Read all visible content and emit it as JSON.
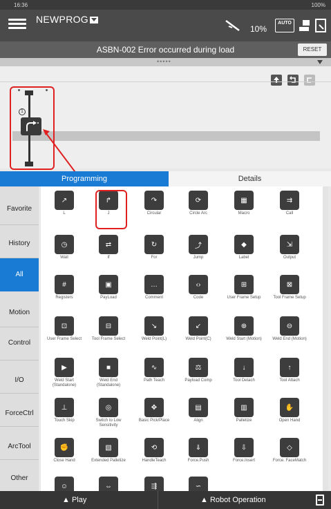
{
  "status_bar": {
    "time": "16:36",
    "battery": "100%"
  },
  "header": {
    "program_name": "NEWPROG",
    "speed_percent": "10%",
    "mode_badge": "AUTO"
  },
  "error_bar": {
    "message": "ASBN-002  Error occurred during load",
    "reset_label": "RESET"
  },
  "editor": {
    "node_number": "1"
  },
  "tabs": [
    {
      "label": "Programming",
      "active": true
    },
    {
      "label": "Details",
      "active": false
    }
  ],
  "categories": [
    {
      "label": "Favorite"
    },
    {
      "label": "History"
    },
    {
      "label": "All",
      "active": true
    },
    {
      "label": "Motion"
    },
    {
      "label": "Control"
    },
    {
      "label": "I/O"
    },
    {
      "label": "ForceCtrl"
    },
    {
      "label": "ArcTool"
    },
    {
      "label": "Other"
    }
  ],
  "commands": [
    {
      "label": "L",
      "icon": "linear-move-icon"
    },
    {
      "label": "J",
      "icon": "joint-move-icon"
    },
    {
      "label": "Circular",
      "icon": "circular-move-icon"
    },
    {
      "label": "Circle Arc",
      "icon": "circle-arc-icon"
    },
    {
      "label": "Macro",
      "icon": "macro-icon"
    },
    {
      "label": "Call",
      "icon": "call-icon"
    },
    {
      "label": "Wait",
      "icon": "stopwatch-icon"
    },
    {
      "label": "If",
      "icon": "if-branch-icon"
    },
    {
      "label": "For",
      "icon": "for-loop-icon"
    },
    {
      "label": "Jump",
      "icon": "jump-icon"
    },
    {
      "label": "Label",
      "icon": "tag-icon"
    },
    {
      "label": "Output",
      "icon": "output-icon"
    },
    {
      "label": "Registers",
      "icon": "registers-icon"
    },
    {
      "label": "PayLoad",
      "icon": "payload-icon"
    },
    {
      "label": "Comment",
      "icon": "comment-icon"
    },
    {
      "label": "Code",
      "icon": "code-icon"
    },
    {
      "label": "User Frame Setup",
      "icon": "user-frame-setup-icon"
    },
    {
      "label": "Tool Frame Setup",
      "icon": "tool-frame-setup-icon"
    },
    {
      "label": "User Frame Select",
      "icon": "user-frame-select-icon"
    },
    {
      "label": "Tool Frame Select",
      "icon": "tool-frame-select-icon"
    },
    {
      "label": "Weld Point(L)",
      "icon": "weld-point-l-icon"
    },
    {
      "label": "Weld Point(C)",
      "icon": "weld-point-c-icon"
    },
    {
      "label": "Weld Start (Motion)",
      "icon": "weld-start-motion-icon"
    },
    {
      "label": "Weld End (Motion)",
      "icon": "weld-end-motion-icon"
    },
    {
      "label": "Weld Start (Standalone)",
      "icon": "weld-start-standalone-icon"
    },
    {
      "label": "Weld End (Standalone)",
      "icon": "weld-end-standalone-icon"
    },
    {
      "label": "Path Teach",
      "icon": "path-teach-icon"
    },
    {
      "label": "Payload Comp",
      "icon": "payload-comp-icon"
    },
    {
      "label": "Tool Detach",
      "icon": "tool-detach-icon"
    },
    {
      "label": "Tool Attach",
      "icon": "tool-attach-icon"
    },
    {
      "label": "Touch Skip",
      "icon": "touch-skip-icon"
    },
    {
      "label": "Switch to Low Sensitivity",
      "icon": "low-sensitivity-icon"
    },
    {
      "label": "Basic Pick/Place",
      "icon": "pick-place-icon"
    },
    {
      "label": "Align",
      "icon": "align-icon"
    },
    {
      "label": "Palletize",
      "icon": "palletize-icon"
    },
    {
      "label": "Open Hand",
      "icon": "open-hand-icon"
    },
    {
      "label": "Close Hand",
      "icon": "close-hand-icon"
    },
    {
      "label": "Extended Palletize",
      "icon": "extended-palletize-icon"
    },
    {
      "label": "HandleTeach",
      "icon": "handle-teach-icon"
    },
    {
      "label": "Force.Push",
      "icon": "force-push-icon"
    },
    {
      "label": "Force.Insert",
      "icon": "force-insert-icon"
    },
    {
      "label": "Force. FaceMatch",
      "icon": "force-facematch-icon"
    },
    {
      "label": "",
      "icon": "robot-icon"
    },
    {
      "label": "",
      "icon": "io-transfer-icon"
    },
    {
      "label": "",
      "icon": "conveyor-icon"
    },
    {
      "label": "",
      "icon": "arc-weld-icon"
    }
  ],
  "bottom_bar": {
    "play_label": "▲ Play",
    "robot_operation_label": "▲ Robot Operation"
  },
  "colors": {
    "accent": "#1a7bd4",
    "highlight": "#e02020",
    "icon_bg": "#3d3d3d"
  }
}
